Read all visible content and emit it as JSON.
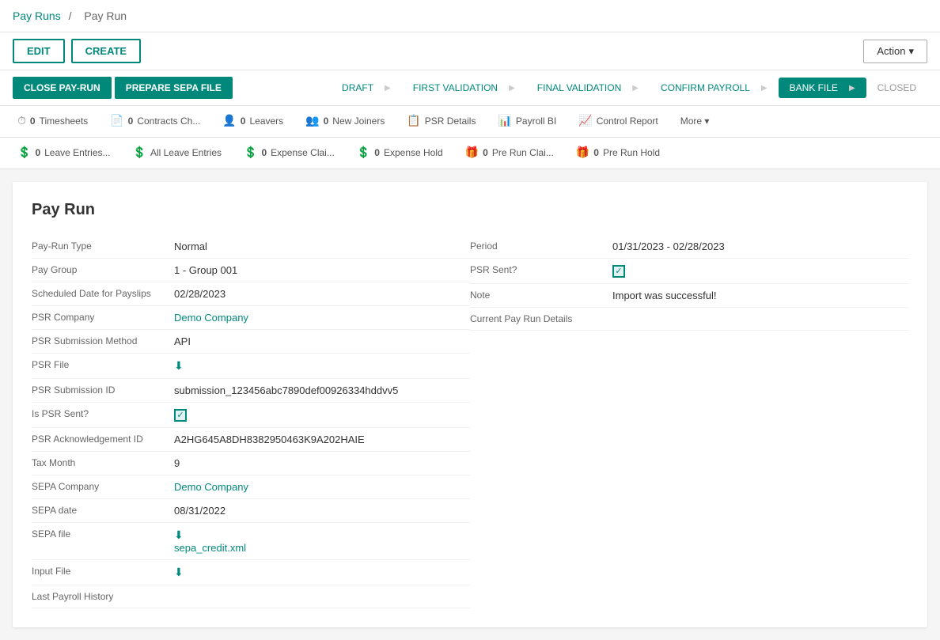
{
  "breadcrumb": {
    "parent_label": "Pay Runs",
    "separator": "/",
    "current_label": "Pay Run"
  },
  "toolbar": {
    "edit_label": "EDIT",
    "create_label": "CREATE",
    "action_label": "Action",
    "action_chevron": "▾"
  },
  "workflow": {
    "close_pay_run_label": "CLOSE PAY-RUN",
    "prepare_sepa_label": "PREPARE SEPA FILE",
    "pipeline_steps": [
      {
        "id": "draft",
        "label": "DRAFT",
        "state": "done"
      },
      {
        "id": "first_validation",
        "label": "FIRST VALIDATION",
        "state": "done"
      },
      {
        "id": "final_validation",
        "label": "FINAL VALIDATION",
        "state": "done"
      },
      {
        "id": "confirm_payroll",
        "label": "CONFIRM PAYROLL",
        "state": "done"
      },
      {
        "id": "bank_file",
        "label": "BANK FILE",
        "state": "active"
      },
      {
        "id": "closed",
        "label": "CLOSED",
        "state": "pending"
      }
    ]
  },
  "tabs_row1": [
    {
      "id": "timesheets",
      "icon": "⏱",
      "count": "0",
      "label": "Timesheets"
    },
    {
      "id": "contracts",
      "icon": "📄",
      "count": "0",
      "label": "Contracts Ch..."
    },
    {
      "id": "leavers",
      "icon": "👤",
      "count": "0",
      "label": "Leavers"
    },
    {
      "id": "new_joiners",
      "icon": "👥",
      "count": "0",
      "label": "New Joiners"
    },
    {
      "id": "psr_details",
      "icon": "📋",
      "count": "",
      "label": "PSR Details"
    },
    {
      "id": "payroll_bi",
      "icon": "📊",
      "count": "",
      "label": "Payroll BI"
    },
    {
      "id": "control_report",
      "icon": "📈",
      "count": "",
      "label": "Control Report"
    },
    {
      "id": "more",
      "icon": "",
      "count": "",
      "label": "More"
    }
  ],
  "tabs_row2": [
    {
      "id": "leave_entries",
      "icon": "💲",
      "count": "0",
      "label": "Leave Entries..."
    },
    {
      "id": "all_leave",
      "icon": "💲",
      "count": "",
      "label": "All Leave Entries"
    },
    {
      "id": "expense_claims",
      "icon": "💲",
      "count": "0",
      "label": "Expense Clai..."
    },
    {
      "id": "expense_hold",
      "icon": "💲",
      "count": "0",
      "label": "Expense Hold"
    },
    {
      "id": "pre_run_claims",
      "icon": "🎁",
      "count": "0",
      "label": "Pre Run Clai..."
    },
    {
      "id": "pre_run_hold",
      "icon": "🎁",
      "count": "0",
      "label": "Pre Run Hold"
    }
  ],
  "pay_run": {
    "title": "Pay Run",
    "fields_left": [
      {
        "label": "Pay-Run Type",
        "value": "Normal",
        "type": "text"
      },
      {
        "label": "Pay Group",
        "value": "1 - Group 001",
        "type": "text"
      },
      {
        "label": "Scheduled Date for Payslips",
        "value": "02/28/2023",
        "type": "text"
      },
      {
        "label": "PSR Company",
        "value": "Demo Company",
        "type": "link"
      },
      {
        "label": "PSR Submission Method",
        "value": "API",
        "type": "text"
      },
      {
        "label": "PSR File",
        "value": "⬇",
        "type": "download"
      },
      {
        "label": "PSR Submission ID",
        "value": "submission_123456abc7890def00926334hddvv5",
        "type": "text"
      },
      {
        "label": "Is PSR Sent?",
        "value": "checked",
        "type": "checkbox"
      },
      {
        "label": "PSR Acknowledgement ID",
        "value": "A2HG645A8DH8382950463K9A202HAIE",
        "type": "text"
      },
      {
        "label": "Tax Month",
        "value": "9",
        "type": "text"
      },
      {
        "label": "SEPA Company",
        "value": "Demo Company",
        "type": "link"
      },
      {
        "label": "SEPA date",
        "value": "08/31/2022",
        "type": "text"
      },
      {
        "label": "SEPA file",
        "value": "sepa_credit.xml",
        "type": "sepa_link"
      },
      {
        "label": "Input File",
        "value": "⬇",
        "type": "download"
      },
      {
        "label": "Last Payroll History",
        "value": "",
        "type": "text"
      }
    ],
    "fields_right": [
      {
        "label": "Period",
        "value": "01/31/2023 - 02/28/2023",
        "type": "text"
      },
      {
        "label": "PSR Sent?",
        "value": "checked",
        "type": "checkbox"
      },
      {
        "label": "Note",
        "value": "Import was successful!",
        "type": "text"
      },
      {
        "label": "Current Pay Run Details",
        "value": "",
        "type": "text"
      }
    ]
  }
}
